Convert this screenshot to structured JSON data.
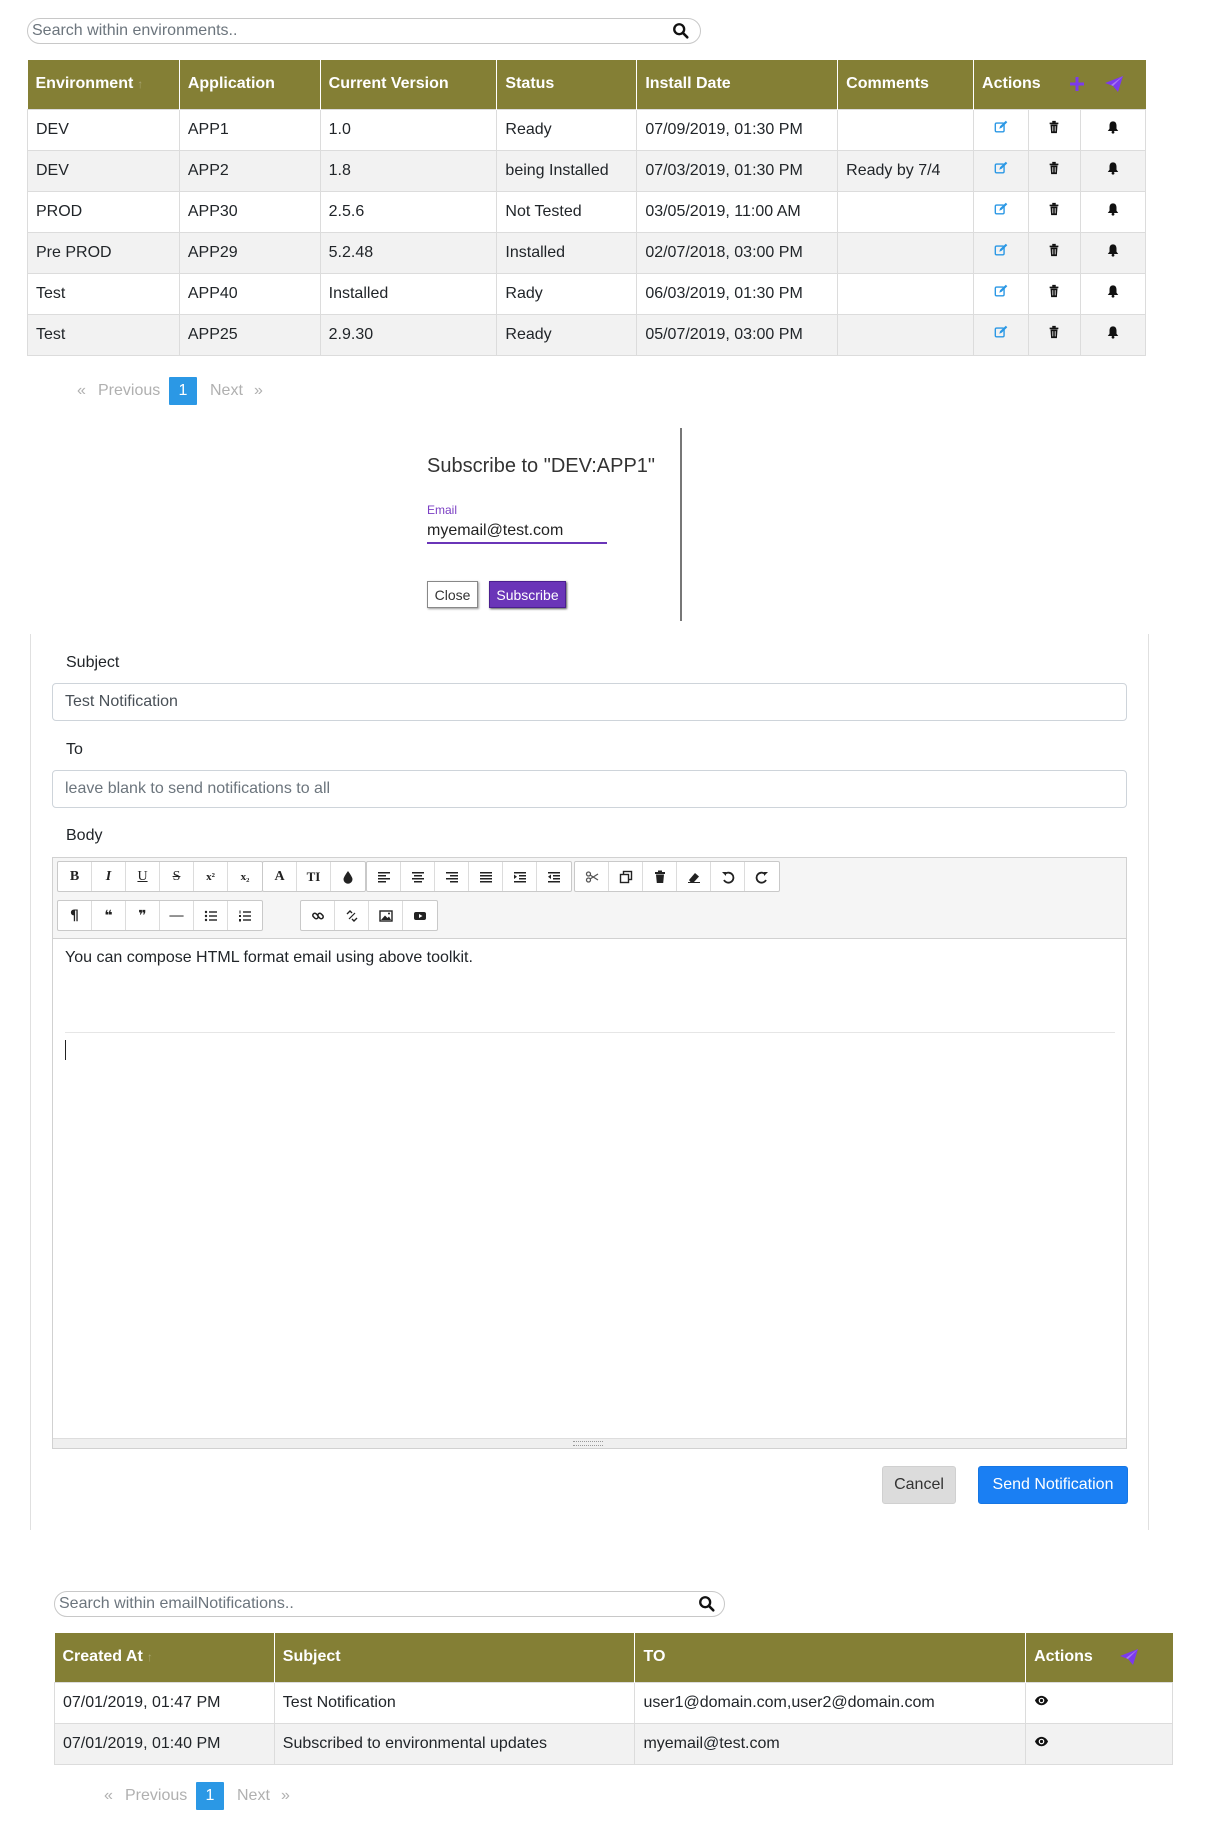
{
  "env_search": {
    "placeholder": "Search within environments.."
  },
  "env_table": {
    "headers": {
      "environment": "Environment",
      "application": "Application",
      "current_version": "Current Version",
      "status": "Status",
      "install_date": "Install Date",
      "comments": "Comments",
      "actions": "Actions"
    },
    "rows": [
      {
        "environment": "DEV",
        "application": "APP1",
        "version": "1.0",
        "status": "Ready",
        "install_date": "07/09/2019, 01:30 PM",
        "comments": ""
      },
      {
        "environment": "DEV",
        "application": "APP2",
        "version": "1.8",
        "status": "being Installed",
        "install_date": "07/03/2019, 01:30 PM",
        "comments": "Ready by 7/4"
      },
      {
        "environment": "PROD",
        "application": "APP30",
        "version": "2.5.6",
        "status": "Not Tested",
        "install_date": "03/05/2019, 11:00 AM",
        "comments": ""
      },
      {
        "environment": "Pre PROD",
        "application": "APP29",
        "version": "5.2.48",
        "status": "Installed",
        "install_date": "02/07/2018, 03:00 PM",
        "comments": ""
      },
      {
        "environment": "Test",
        "application": "APP40",
        "version": "Installed",
        "status": "Rady",
        "install_date": "06/03/2019, 01:30 PM",
        "comments": ""
      },
      {
        "environment": "Test",
        "application": "APP25",
        "version": "2.9.30",
        "status": "Ready",
        "install_date": "05/07/2019, 03:00 PM",
        "comments": ""
      }
    ],
    "icons": {
      "add": "plus-icon",
      "notify": "paper-plane-icon",
      "edit": "edit-icon",
      "delete": "trash-icon",
      "subscribe": "bell-icon"
    }
  },
  "env_pager": {
    "prev": "«",
    "previous": "Previous",
    "page": "1",
    "next": "Next",
    "last": "»"
  },
  "subscribe_dialog": {
    "title": "Subscribe to \"DEV:APP1\"",
    "email_label": "Email",
    "email_value": "myemail@test.com",
    "close_label": "Close",
    "subscribe_label": "Subscribe"
  },
  "notify_form": {
    "subject_label": "Subject",
    "subject_value": "Test Notification",
    "to_label": "To",
    "to_placeholder": "leave blank to send notifications to all",
    "body_label": "Body",
    "body_text": "You can compose HTML format email using above toolkit.",
    "toolbar_row1": {
      "bold": "B",
      "italic": "I",
      "underline": "U",
      "strike": "S",
      "superscript": "x²",
      "subscript": "x₂",
      "font": "A",
      "text_size": "TI",
      "color": "💧"
    },
    "toolbar_row2": {
      "paragraph": "¶",
      "quote_open": "❝",
      "quote_close": "❞",
      "hr": "—"
    },
    "cancel_label": "Cancel",
    "send_label": "Send Notification"
  },
  "notif_search": {
    "placeholder": "Search within emailNotifications.."
  },
  "notif_table": {
    "headers": {
      "created_at": "Created At",
      "subject": "Subject",
      "to": "TO",
      "actions": "Actions"
    },
    "rows": [
      {
        "created_at": "07/01/2019, 01:47 PM",
        "subject": "Test Notification",
        "to": "user1@domain.com,user2@domain.com"
      },
      {
        "created_at": "07/01/2019, 01:40 PM",
        "subject": "Subscribed to environmental updates",
        "to": "myemail@test.com"
      }
    ],
    "icons": {
      "send": "paper-plane-icon",
      "view": "eye-icon"
    }
  },
  "notif_pager": {
    "prev": "«",
    "previous": "Previous",
    "page": "1",
    "next": "Next",
    "last": "»"
  },
  "colors": {
    "header_olive": "#847f35",
    "accent_purple": "#7c3aed",
    "link_blue": "#2b98e5",
    "send_blue": "#1a7ff3"
  }
}
